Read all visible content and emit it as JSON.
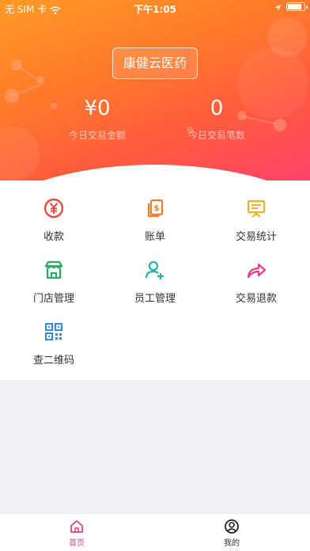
{
  "status_bar": {
    "carrier": "无 SIM 卡",
    "time": "下午1:05"
  },
  "header": {
    "store_name": "康健云医药",
    "stats": [
      {
        "value": "¥0",
        "label": "今日交易金额"
      },
      {
        "value": "0",
        "label": "今日交易笔数"
      }
    ]
  },
  "menu": [
    {
      "label": "收款",
      "icon": "yen-circle-icon",
      "color": "#e94b3c"
    },
    {
      "label": "账单",
      "icon": "bill-icon",
      "color": "#f07d2a"
    },
    {
      "label": "交易统计",
      "icon": "statistics-board-icon",
      "color": "#f5b120"
    },
    {
      "label": "门店管理",
      "icon": "store-icon",
      "color": "#27ae60"
    },
    {
      "label": "员工管理",
      "icon": "add-user-icon",
      "color": "#1fb5a8"
    },
    {
      "label": "交易退款",
      "icon": "refund-arrow-icon",
      "color": "#e83e8c"
    },
    {
      "label": "查二维码",
      "icon": "qr-code-icon",
      "color": "#2f8be6"
    }
  ],
  "tabbar": {
    "tabs": [
      {
        "label": "首页",
        "icon": "home-icon",
        "active": true
      },
      {
        "label": "我的",
        "icon": "profile-icon",
        "active": false
      }
    ],
    "active_color": "#e83e8c",
    "inactive_color": "#333333"
  }
}
